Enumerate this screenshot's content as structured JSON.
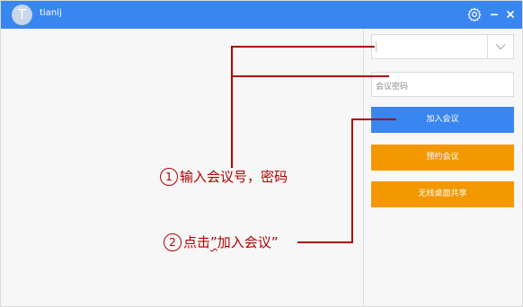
{
  "titlebar": {
    "avatar_initial": "T",
    "username": "tianlj",
    "bg_color": "#3a86f0",
    "icons": [
      "gear-icon",
      "minimize-icon",
      "close-icon"
    ]
  },
  "form": {
    "meeting_number": {
      "value": "",
      "placeholder": ""
    },
    "password": {
      "placeholder": "会议密码"
    }
  },
  "buttons": {
    "join_label": "加入会议",
    "reserve_label": "预约会议",
    "share_label": "无线桌面共享"
  },
  "colors": {
    "primary": "#3a86f0",
    "orange": "#f39800",
    "annotation": "#b00000"
  },
  "annotations": {
    "step1": {
      "number": "1",
      "text": "输入会议号，密码"
    },
    "step2": {
      "number": "2",
      "prefix": "点击",
      "open_quote": "”",
      "quoted": "加入会议",
      "close_quote": "”"
    }
  }
}
